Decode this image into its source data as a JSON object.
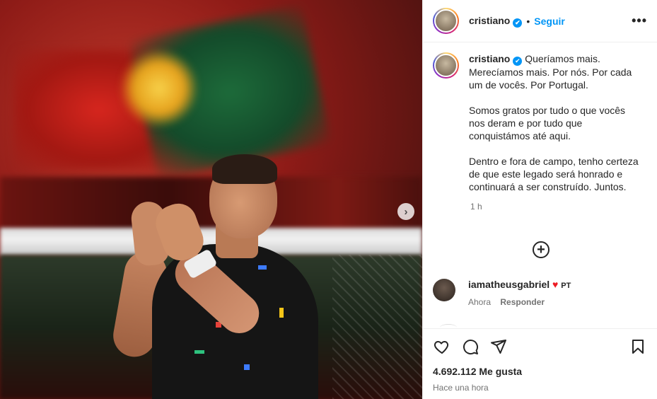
{
  "post": {
    "username": "cristiano",
    "follow_label": "Seguir",
    "dot": "•",
    "more_label": "•••",
    "next_label": "›",
    "caption": "Queríamos mais. Merecíamos mais. Por nós. Por cada um de vocês. Por Portugal.\n\nSomos gratos por tudo o que vocês nos deram e por tudo que conquistámos até aqui.\n\nDentro e fora de campo, tenho certeza de que este legado será honrado e continuará a ser construído. Juntos.",
    "caption_time": "1 h",
    "add_label": "+",
    "likes": "4.692.112 Me gusta",
    "posted_ago": "Hace una hora"
  },
  "comment": {
    "username": "iamatheusgabriel",
    "heart": "♥",
    "text": "PT",
    "time": "Ahora",
    "reply_label": "Responder"
  },
  "icons": {
    "verified": "✔",
    "like": "heart-icon",
    "comment": "comment-icon",
    "share": "share-icon",
    "save": "bookmark-icon"
  },
  "colors": {
    "accent": "#0095f6",
    "text": "#262626",
    "muted": "#737373",
    "heart": "#ed1c24"
  }
}
